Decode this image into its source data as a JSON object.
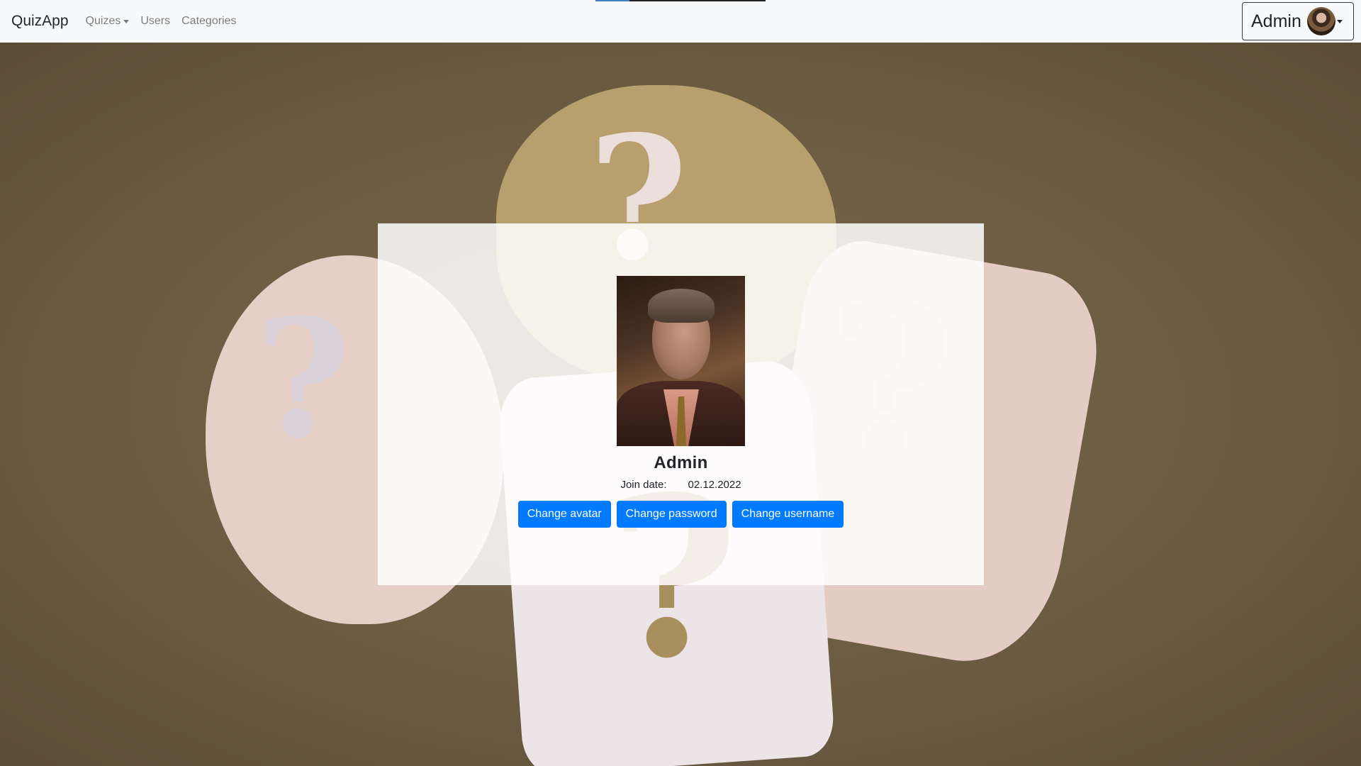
{
  "navbar": {
    "brand": "QuizApp",
    "items": [
      {
        "label": "Quizes",
        "dropdown": true
      },
      {
        "label": "Users",
        "dropdown": false
      },
      {
        "label": "Categories",
        "dropdown": false
      }
    ],
    "user_menu": {
      "label": "Admin",
      "avatar_icon": "user-avatar"
    }
  },
  "profile": {
    "name": "Admin",
    "join_label": "Join date:",
    "join_date": "02.12.2022",
    "buttons": {
      "change_avatar": "Change avatar",
      "change_password": "Change password",
      "change_username": "Change username"
    }
  },
  "colors": {
    "primary": "#007bff",
    "navbar_bg": "#f8f9fa",
    "background": "#6f5f45"
  }
}
